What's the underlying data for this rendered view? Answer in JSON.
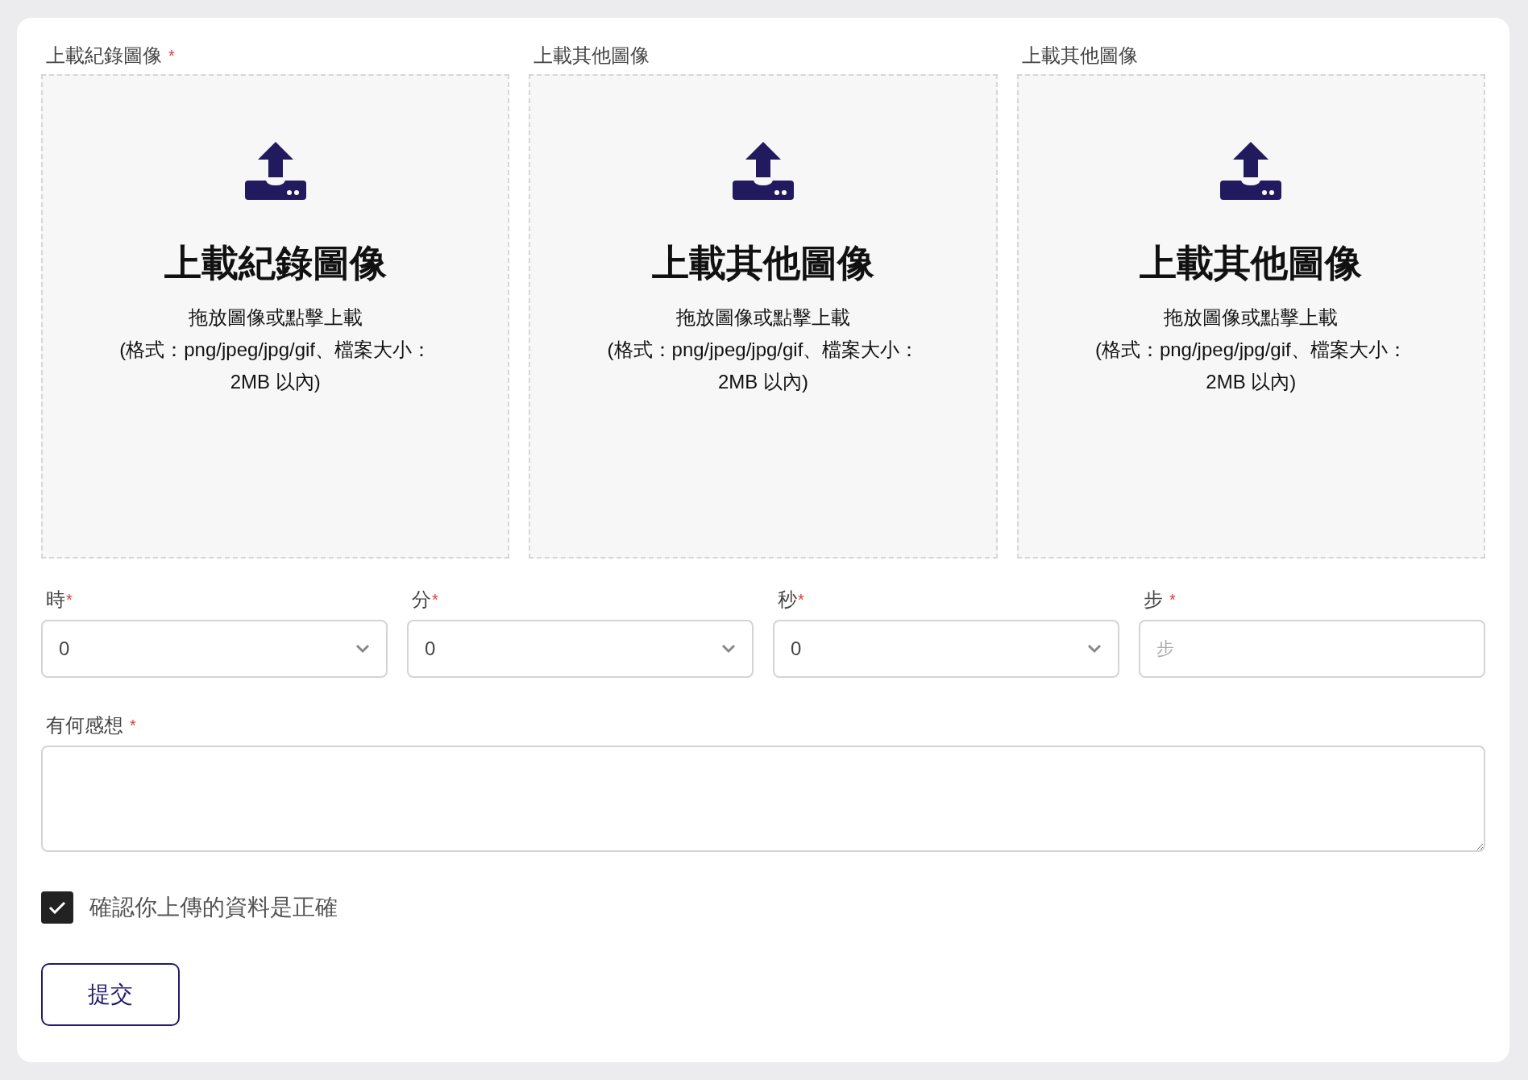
{
  "uploads": [
    {
      "label": "上載紀錄圖像",
      "mark": "*",
      "title": "上載紀錄圖像",
      "hint": "拖放圖像或點擊上載",
      "format": "(格式：png/jpeg/jpg/gif、檔案大小：2MB 以內)"
    },
    {
      "label": "上載其他圖像",
      "title": "上載其他圖像",
      "hint": "拖放圖像或點擊上載",
      "format": "(格式：png/jpeg/jpg/gif、檔案大小：2MB 以內)"
    },
    {
      "label": "上載其他圖像",
      "title": "上載其他圖像",
      "hint": "拖放圖像或點擊上載",
      "format": "(格式：png/jpeg/jpg/gif、檔案大小：2MB 以內)"
    }
  ],
  "time_fields": [
    {
      "kind": "select",
      "label": "時",
      "mark": "*",
      "value": "0"
    },
    {
      "kind": "select",
      "label": "分",
      "mark": "*",
      "value": "0"
    },
    {
      "kind": "select",
      "label": "秒",
      "mark": "*",
      "value": "0"
    },
    {
      "kind": "input",
      "label": "步",
      "mark": "*",
      "placeholder": "步"
    }
  ],
  "feedback": {
    "label": "有何感想",
    "mark": "*"
  },
  "confirm": {
    "label": "確認你上傳的資料是正確",
    "checked": true
  },
  "submit": {
    "label": "提交"
  }
}
